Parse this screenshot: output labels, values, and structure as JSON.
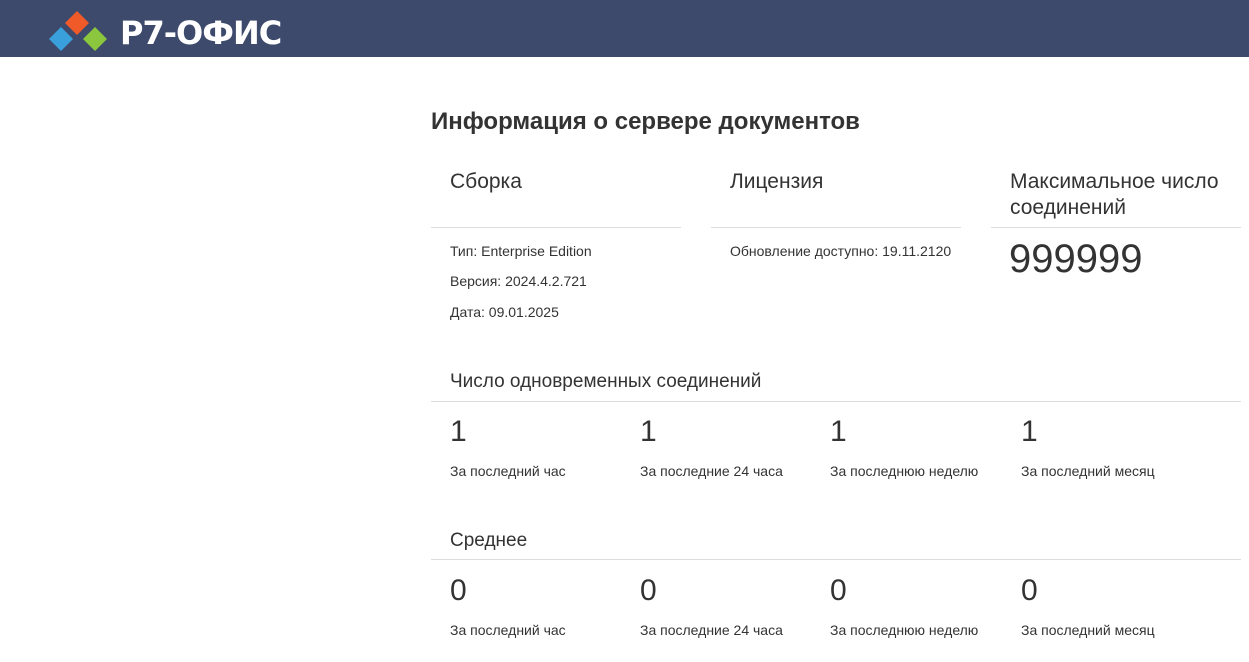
{
  "header": {
    "brand": "Р7-ОФИС",
    "colors": {
      "bar": "#3d4a6b",
      "logo_orange": "#f05a28",
      "logo_blue": "#3aa0dc",
      "logo_green": "#8cc63f"
    }
  },
  "page_title": "Информация о сервере документов",
  "build": {
    "title": "Сборка",
    "type": "Тип: Enterprise Edition",
    "version": "Версия: 2024.4.2.721",
    "date": "Дата: 09.01.2025"
  },
  "license": {
    "title": "Лицензия",
    "update": "Обновление доступно: 19.11.2120"
  },
  "max_connections": {
    "title_line1": "Максимальное число",
    "title_line2": "соединений",
    "value": "999999"
  },
  "concurrent": {
    "title": "Число одновременных соединений",
    "stats": [
      {
        "value": "1",
        "label": "За последний час"
      },
      {
        "value": "1",
        "label": "За последние 24 часа"
      },
      {
        "value": "1",
        "label": "За последнюю неделю"
      },
      {
        "value": "1",
        "label": "За последний месяц"
      }
    ]
  },
  "average": {
    "title": "Среднее",
    "stats": [
      {
        "value": "0",
        "label": "За последний час"
      },
      {
        "value": "0",
        "label": "За последние 24 часа"
      },
      {
        "value": "0",
        "label": "За последнюю неделю"
      },
      {
        "value": "0",
        "label": "За последний месяц"
      }
    ]
  }
}
